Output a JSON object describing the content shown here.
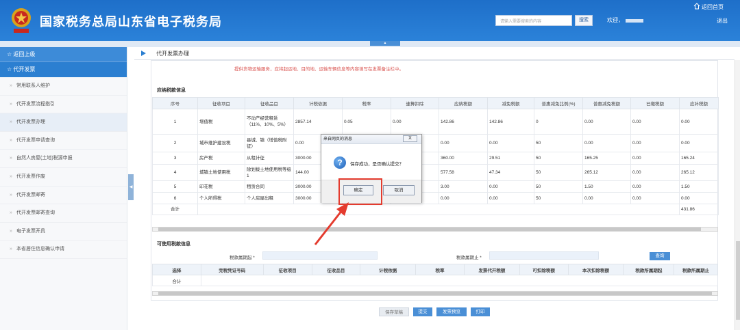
{
  "header": {
    "title": "国家税务总局山东省电子税务局",
    "search_placeholder": "请输入需要搜索的内容",
    "search_button": "搜索",
    "welcome": "欢迎，",
    "home_link": "返回首页",
    "logout": "退出"
  },
  "sidebar": {
    "back": "返回上级",
    "menu_title": "代开发票",
    "items": [
      {
        "label": "常用联系人维护"
      },
      {
        "label": "代开发票流程指引"
      },
      {
        "label": "代开发票办理"
      },
      {
        "label": "代开发票申请查询"
      },
      {
        "label": "自然人房屋(土地)税源申报"
      },
      {
        "label": "代开发票作废"
      },
      {
        "label": "代开发票邮寄"
      },
      {
        "label": "代开发票邮寄查询"
      },
      {
        "label": "电子发票开具"
      },
      {
        "label": "本省居住信息确认申请"
      }
    ]
  },
  "breadcrumb": "代开发票办理",
  "notice": "提供货物运输服务，应将起运地、目的地、运输车辆信息等内容填写在发票备注栏中。",
  "tax_section": {
    "title": "应纳税款信息",
    "headers": [
      "序号",
      "征收项目",
      "征收品目",
      "计税依据",
      "税率",
      "速算扣除",
      "应纳税额",
      "减免税额",
      "普惠减免比例(%)",
      "普惠减免税额",
      "已缴税额",
      "应补税额"
    ],
    "rows": [
      [
        "1",
        "增值税",
        "不动产经营租赁（11%、10%、5%）",
        "2857.14",
        "0.05",
        "0.00",
        "142.86",
        "142.86",
        "0",
        "0.00",
        "0.00",
        "0.00"
      ],
      [
        "2",
        "城市维护建设税",
        "县城、镇（增值税附征）",
        "0.00",
        "",
        "",
        "0.00",
        "0.00",
        "50",
        "0.00",
        "0.00",
        "0.00"
      ],
      [
        "3",
        "房产税",
        "从租计征",
        "3000.00",
        "",
        "",
        "360.00",
        "29.51",
        "50",
        "165.25",
        "0.00",
        "165.24"
      ],
      [
        "4",
        "城镇土地使用税",
        "除划拨土地使用税等级1",
        "144.00",
        "",
        "",
        "577.58",
        "47.34",
        "50",
        "265.12",
        "0.00",
        "265.12"
      ],
      [
        "5",
        "印花税",
        "租赁合同",
        "3000.00",
        "",
        "",
        "3.00",
        "0.00",
        "50",
        "1.50",
        "0.00",
        "1.50"
      ],
      [
        "6",
        "个人所得税",
        "个人房屋出租",
        "3000.00",
        "",
        "",
        "0.00",
        "0.00",
        "50",
        "0.00",
        "0.00",
        "0.00"
      ]
    ],
    "total_label": "合计",
    "total_value": "431.86"
  },
  "offset_section": {
    "title": "可使用税款信息",
    "start_label": "税款属期起 *",
    "end_label": "税款属期止 *",
    "query_button": "查询",
    "headers": [
      "选择",
      "完税凭证号码",
      "征收项目",
      "征收品目",
      "计税依据",
      "税率",
      "发票代开税额",
      "可扣除税额",
      "本次扣除税额",
      "税款所属期起",
      "税款所属期止"
    ],
    "total_label": "合计"
  },
  "bottom_buttons": {
    "save_draft": "保存草稿",
    "submit": "提交",
    "preview": "发票预览",
    "print": "打印"
  },
  "dialog": {
    "title": "来自网页的消息",
    "close": "X",
    "message": "保存成功，是否确认提交？",
    "ok": "确定",
    "cancel": "取消"
  },
  "colors": {
    "header_blue": "#2b7fd1",
    "highlight_red": "#e43b2e",
    "notice_red": "#d9534f"
  }
}
